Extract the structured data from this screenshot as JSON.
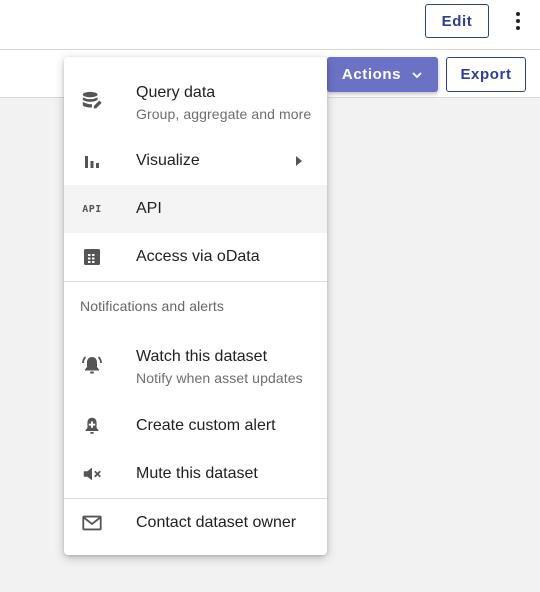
{
  "header": {
    "edit_label": "Edit",
    "more_icon": "more-vert-icon"
  },
  "toolbar": {
    "actions_label": "Actions",
    "export_label": "Export"
  },
  "menu": {
    "query": {
      "label": "Query data",
      "sub": "Group, aggregate and more",
      "icon": "database-edit-icon"
    },
    "visualize": {
      "label": "Visualize",
      "icon": "bar-chart-icon"
    },
    "api": {
      "label": "API",
      "icon_text": "API"
    },
    "odata": {
      "label": "Access via oData",
      "icon": "table-icon"
    },
    "section_title": "Notifications and alerts",
    "watch": {
      "label": "Watch this dataset",
      "sub": "Notify when asset updates",
      "icon": "bell-ring-icon"
    },
    "custom_alert": {
      "label": "Create custom alert",
      "icon": "bell-plus-icon"
    },
    "mute": {
      "label": "Mute this dataset",
      "icon": "volume-off-icon"
    },
    "contact": {
      "label": "Contact dataset owner",
      "icon": "mail-icon"
    }
  },
  "colors": {
    "primary": "#2f3f8f",
    "actions_bg": "#6b72c6",
    "menu_highlight": "#f4f4f4"
  }
}
